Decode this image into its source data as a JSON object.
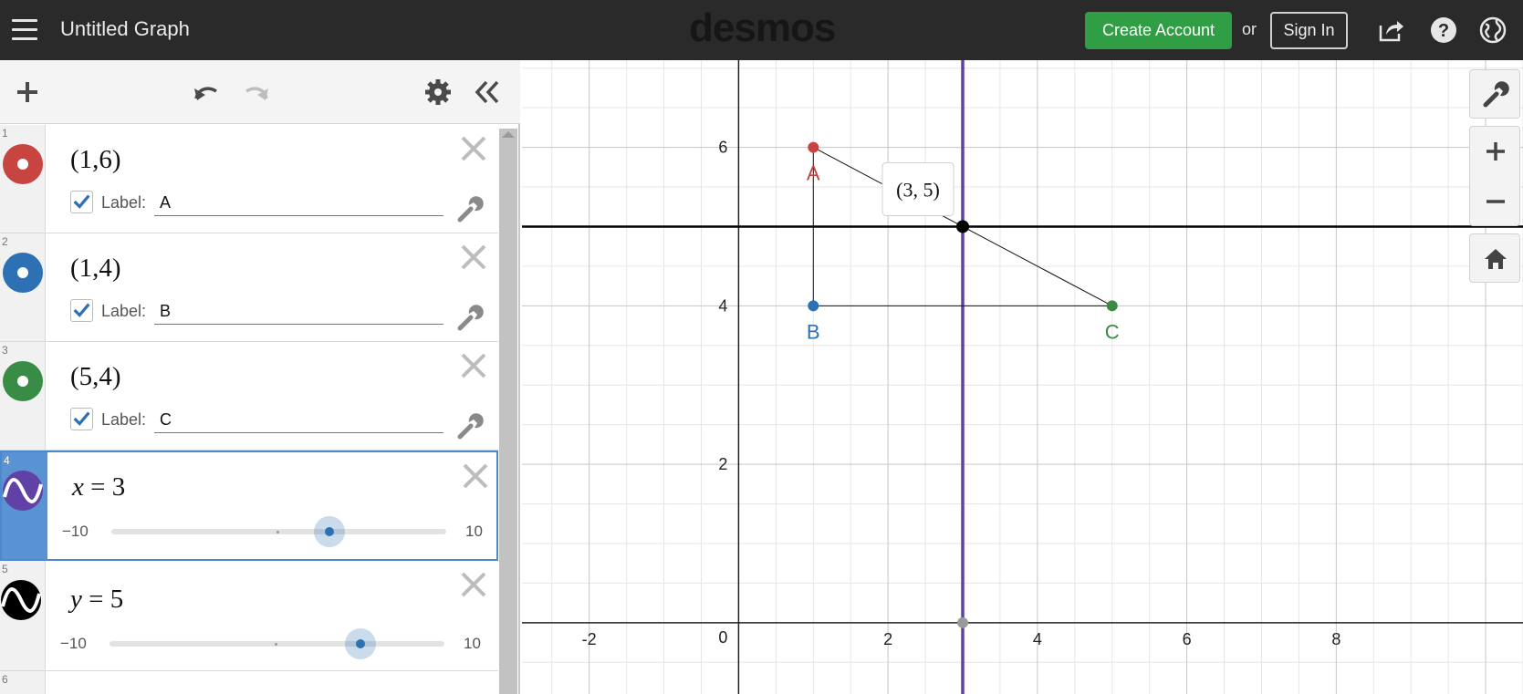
{
  "header": {
    "title": "Untitled Graph",
    "logo": "desmos",
    "create_account": "Create Account",
    "or": "or",
    "sign_in": "Sign In"
  },
  "expressions": [
    {
      "index": "1",
      "math": "(1,6)",
      "label_prefix": "Label:",
      "label_value": "A",
      "color": "#c74440",
      "checked": true
    },
    {
      "index": "2",
      "math": "(1,4)",
      "label_prefix": "Label:",
      "label_value": "B",
      "color": "#2d70b3",
      "checked": true
    },
    {
      "index": "3",
      "math": "(5,4)",
      "label_prefix": "Label:",
      "label_value": "C",
      "color": "#388c46",
      "checked": true
    },
    {
      "index": "4",
      "math_var": "x",
      "math_rest": " = 3",
      "slider_min": "−10",
      "slider_max": "10",
      "slider_value": 3,
      "color": "#6042a6"
    },
    {
      "index": "5",
      "math_var": "y",
      "math_rest": " = 5",
      "slider_min": "−10",
      "slider_max": "10",
      "slider_value": 5,
      "color": "#000000"
    }
  ],
  "next_index": "6",
  "graph": {
    "points": [
      {
        "name": "A",
        "x": 1,
        "y": 6,
        "color": "#c74440"
      },
      {
        "name": "B",
        "x": 1,
        "y": 4,
        "color": "#2d70b3"
      },
      {
        "name": "C",
        "x": 5,
        "y": 4,
        "color": "#388c46"
      }
    ],
    "intersection": {
      "x": 3,
      "y": 5,
      "label": "(3, 5)"
    },
    "vertical_line_x": 3,
    "horizontal_line_y": 5,
    "x_ticks": [
      "-2",
      "2",
      "4",
      "6",
      "8"
    ],
    "y_ticks": [
      "2",
      "4",
      "6"
    ],
    "origin_label": "0",
    "x_range": [
      -2.9,
      10.5
    ],
    "y_range": [
      -0.9,
      7.1
    ]
  },
  "icons": {
    "menu": "hamburger-icon",
    "share": "share-icon",
    "help": "help-icon",
    "language": "globe-icon",
    "add": "plus-icon",
    "undo": "undo-icon",
    "redo": "redo-icon",
    "settings": "gear-icon",
    "collapse": "double-chevron-left-icon",
    "graph_settings": "wrench-icon",
    "zoom_in": "plus-icon",
    "zoom_out": "minus-icon",
    "home": "home-icon"
  }
}
